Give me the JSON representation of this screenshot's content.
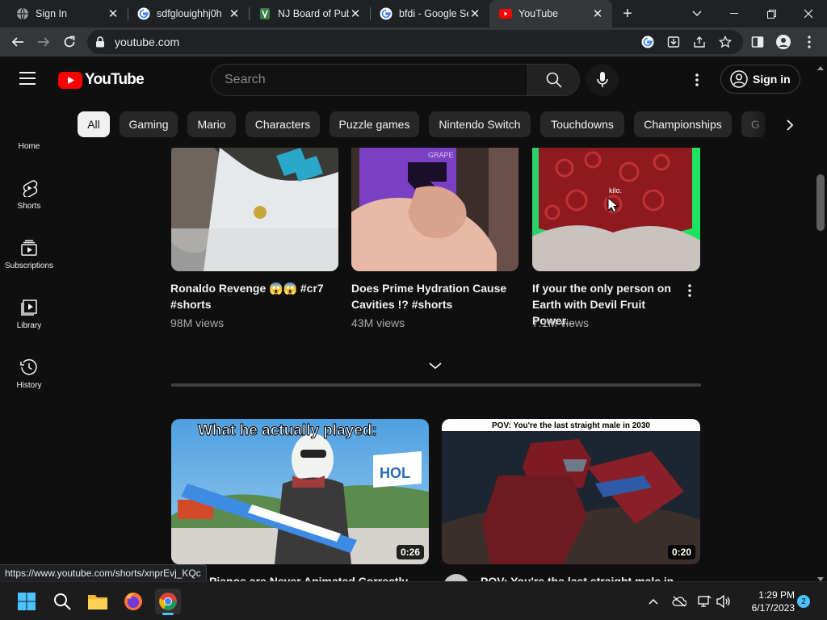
{
  "browser": {
    "tabs": [
      {
        "title": "Sign In",
        "icon": "globe-icon"
      },
      {
        "title": "sdfglouighhj0h",
        "icon": "google-icon"
      },
      {
        "title": "NJ Board of Pub",
        "icon": "nj-seal-icon"
      },
      {
        "title": "bfdi - Google Se",
        "icon": "google-icon"
      },
      {
        "title": "YouTube",
        "icon": "youtube-icon",
        "active": true
      }
    ],
    "new_tab_label": "+",
    "url": "youtube.com",
    "status_url": "https://www.youtube.com/shorts/xnprEvj_KQc"
  },
  "youtube": {
    "logo_text": "YouTube",
    "search_placeholder": "Search",
    "signin_label": "Sign in",
    "chips": [
      "All",
      "Gaming",
      "Mario",
      "Characters",
      "Puzzle games",
      "Nintendo Switch",
      "Touchdowns",
      "Championships",
      "G"
    ],
    "guide": [
      {
        "label": "Home",
        "icon": "home-icon"
      },
      {
        "label": "Shorts",
        "icon": "shorts-icon"
      },
      {
        "label": "Subscriptions",
        "icon": "subscriptions-icon"
      },
      {
        "label": "Library",
        "icon": "library-icon"
      },
      {
        "label": "History",
        "icon": "history-icon"
      }
    ],
    "shorts": [
      {
        "title_line1": "Ronaldo Revenge 😱😱 #cr7",
        "title_line2": "#shorts",
        "views": "98M views"
      },
      {
        "title_line1": "Does Prime Hydration Cause",
        "title_line2": "Cavities !? #shorts",
        "views": "43M views"
      },
      {
        "title_line1": "If your the only person on",
        "title_line2": "Earth with Devil Fruit Power...",
        "views": "7.1M views"
      }
    ],
    "thumb_texts": {
      "grape": "GRAPE",
      "kilo": "kilo."
    },
    "videos": [
      {
        "overlay_text": "What he actually played:",
        "sign_text": "HOL",
        "duration": "0:26",
        "title": "Pianos are Never Animated Correctly..."
      },
      {
        "overlay_text": "POV: You're the last straight male in 2030",
        "duration": "0:20",
        "title": "POV: You're the last straight male in..."
      }
    ]
  },
  "taskbar": {
    "time": "1:29 PM",
    "date": "6/17/2023",
    "notifications": "2"
  },
  "colors": {
    "youtube_red": "#ff0000",
    "background": "#0f0f0f",
    "chip_selected": "#f1f1f1",
    "chrome_tabstrip": "#202124"
  }
}
